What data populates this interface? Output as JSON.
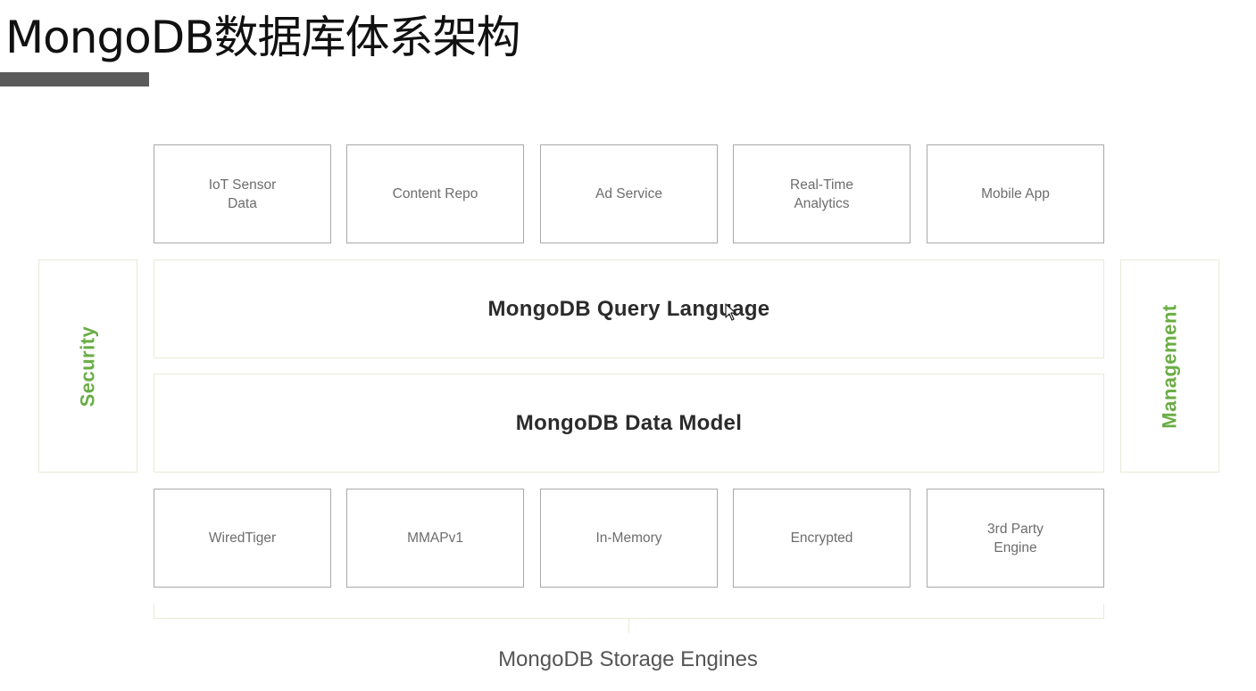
{
  "title": "MongoDB数据库体系架构",
  "colors": {
    "accent_green": "#6aad45",
    "box_border": "#a9a9a9",
    "title_bar": "#5a5a5a"
  },
  "apps": [
    {
      "label": "IoT Sensor\nData"
    },
    {
      "label": "Content Repo"
    },
    {
      "label": "Ad Service"
    },
    {
      "label": "Real-Time\nAnalytics"
    },
    {
      "label": "Mobile App"
    }
  ],
  "layers": {
    "query_language": "MongoDB Query Language",
    "data_model": "MongoDB Data Model"
  },
  "side": {
    "left": "Security",
    "right": "Management"
  },
  "engines": [
    {
      "label": "WiredTiger"
    },
    {
      "label": "MMAPv1"
    },
    {
      "label": "In-Memory"
    },
    {
      "label": "Encrypted"
    },
    {
      "label": "3rd Party\nEngine"
    }
  ],
  "storage_caption": "MongoDB Storage Engines",
  "cursor_icon": "mouse-pointer-icon"
}
